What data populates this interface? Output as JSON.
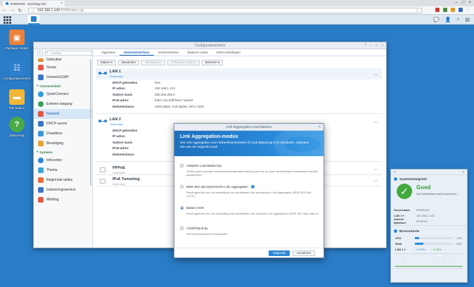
{
  "browser": {
    "tab_title": "ExtDS418 - Synology Dis",
    "url_host": "192.168.1.143",
    "url_path": ":5000/index.cgi"
  },
  "desktop": {
    "icons": [
      {
        "label": "Package Center"
      },
      {
        "label": "Configuratiescherm"
      },
      {
        "label": "File Station"
      },
      {
        "label": "DSM Help"
      }
    ]
  },
  "window": {
    "title": "Configuratiescherm",
    "search_placeholder": "Zoeken",
    "sidebar": {
      "items_top": [
        {
          "label": "Gebruiker"
        },
        {
          "label": "Groep"
        },
        {
          "label": "Domein/LDAP"
        }
      ],
      "section1": "Connectiviteit",
      "items_conn": [
        {
          "label": "QuickConnect"
        },
        {
          "label": "Externe toegang"
        },
        {
          "label": "Netwerk"
        },
        {
          "label": "DHCP-server"
        },
        {
          "label": "Draadloos"
        },
        {
          "label": "Beveiliging"
        }
      ],
      "section2": "Systeem",
      "items_sys": [
        {
          "label": "Infocenter"
        },
        {
          "label": "Thema"
        },
        {
          "label": "Regionale opties"
        },
        {
          "label": "Indexeringsservice"
        },
        {
          "label": "Melding"
        }
      ]
    },
    "tabs": [
      "Algemeen",
      "Netwerkinterface",
      "Verkeerbeheer",
      "Statisch routes",
      "DSM-instellingen"
    ],
    "toolbar": {
      "create": "Maken ▾",
      "edit": "Bewerken",
      "delete": "Verwijderen",
      "disconnect": "Verbinding maken",
      "manage": "Beheren ▾"
    },
    "lan1": {
      "name": "LAN 1",
      "status": "Verbonden",
      "rows": [
        {
          "k": "DHCP gebruiken",
          "v": "Nee"
        },
        {
          "k": "IP-adres",
          "v": "192.168.1.143"
        },
        {
          "k": "Subnet mask",
          "v": "255.255.255.0"
        },
        {
          "k": "IPv6-adres",
          "v": "fe80::211:32ff:fe4a:71a4/64"
        },
        {
          "k": "Netwerkstatus",
          "v": "1000 Mbps, Full duplex, MTU 1500"
        }
      ]
    },
    "lan2": {
      "name": "LAN 2",
      "status": "Verbonden",
      "rows": [
        {
          "k": "DHCP gebruiken"
        },
        {
          "k": "IP-adres"
        },
        {
          "k": "Subnet mask"
        },
        {
          "k": "IPv6-adres"
        },
        {
          "k": "Netwerkstatus"
        }
      ]
    },
    "pppoe": {
      "name": "PPPoE",
      "status": "Verbroken"
    },
    "ipv6t": {
      "name": "IPv6 Tunneling",
      "status": "Verbroken"
    }
  },
  "modal": {
    "title": "Link Aggregation inschakelen",
    "heading": "Link Aggregation-modus",
    "description": "Om Link Aggregation voor netwerkfoutmarantie of Load Balancing in te schakelen, selecteer een van de volgende modi",
    "options": [
      {
        "label": "Adaptive Load Balancing",
        "desc": "Vereist geen speciale netwerkschakelaarondersteuning en kan op twee verschillende schakelaars worden aangesloten.",
        "selected": false
      },
      {
        "label": "IEEE 802.3ad dynamische Link Aggregation",
        "desc": "Wordt gebruikt voor de aansluiting van schakelaars die dynamische Link Aggregation (IEEE 802.3ad LACP).",
        "selected": false
      },
      {
        "label": "Balans XOR",
        "desc": "Wordt gebruikt voor de aansluiting van schakelaars die statische Link Aggregation (IEEE 802.3ad) draft v1.",
        "selected": true
      },
      {
        "label": "Actief/Stand-by",
        "desc": "Het biedt uitsluitend foutmarantie.",
        "selected": false
      }
    ],
    "next": "Volgende",
    "cancel": "Annuleren"
  },
  "widget": {
    "health_title": "Systeemintegriteit",
    "health_status": "Goed",
    "health_desc": "Uw DiskStation werkt naar beho...",
    "kv": [
      {
        "k": "Servernaam",
        "v": "ExtDS418"
      },
      {
        "k": "LAN 1 ▾",
        "v": "192.168.1.143"
      },
      {
        "k": "Actieve tijdsduur",
        "v": "00:25:09"
      }
    ],
    "resource_title": "Broncontrole",
    "cpu_label": "CPU",
    "cpu_value": "11%",
    "cpu_pct": 11,
    "ram_label": "RAM",
    "ram_value": "22%",
    "ram_pct": 22,
    "lan_label": "LAN 1 ▾",
    "lan_up": "↑ 0 KB/s",
    "lan_down": "↓ 0 KB/s"
  }
}
